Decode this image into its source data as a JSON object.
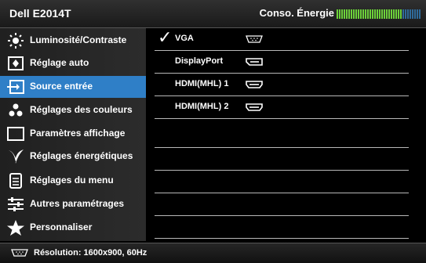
{
  "header": {
    "model": "Dell E2014T",
    "energy_label": "Conso. Énergie",
    "energy_level": 0.78
  },
  "menu": {
    "items": [
      {
        "label": "Luminosité/Contraste",
        "icon": "brightness-icon"
      },
      {
        "label": "Réglage auto",
        "icon": "auto-adjust-icon"
      },
      {
        "label": "Source entrée",
        "icon": "input-source-icon",
        "selected": true
      },
      {
        "label": "Réglages des couleurs",
        "icon": "color-settings-icon"
      },
      {
        "label": "Paramètres affichage",
        "icon": "display-settings-icon"
      },
      {
        "label": "Réglages énergétiques",
        "icon": "energy-settings-icon"
      },
      {
        "label": "Réglages du menu",
        "icon": "menu-settings-icon"
      },
      {
        "label": "Autres paramétrages",
        "icon": "other-settings-icon"
      },
      {
        "label": "Personnaliser",
        "icon": "star-icon"
      }
    ]
  },
  "source_options": [
    {
      "label": "VGA",
      "checked": true,
      "icon": "vga-port-icon"
    },
    {
      "label": "DisplayPort",
      "checked": false,
      "icon": "displayport-icon"
    },
    {
      "label": "HDMI(MHL) 1",
      "checked": false,
      "icon": "hdmi-port-icon"
    },
    {
      "label": "HDMI(MHL) 2",
      "checked": false,
      "icon": "hdmi-port-icon"
    }
  ],
  "footer": {
    "resolution_text": "Résolution: 1600x900, 60Hz",
    "icon": "vga-port-icon"
  },
  "colors": {
    "selected": "#2f7fc7",
    "meter_active": "#6cd13a",
    "meter_inactive": "#2f6a9a"
  }
}
